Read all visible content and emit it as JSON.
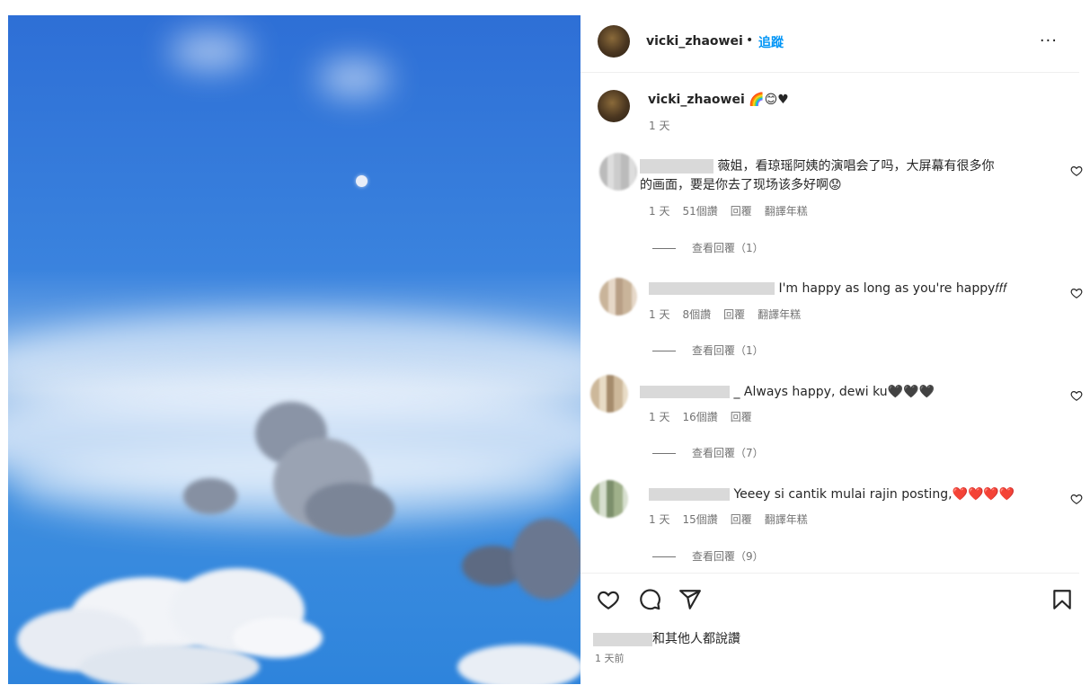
{
  "post": {
    "author": "vicki_zhaowei",
    "dot": "•",
    "follow_label": "追蹤",
    "more_label": "···",
    "caption": "🌈😊♥",
    "caption_time": "1 天"
  },
  "comments": [
    {
      "text_lines": [
        "薇姐，看琼瑶阿姨的演唱会了吗，大屏幕有很多你",
        "的画面，要是你去了现场该多好啊😟"
      ],
      "time": "1 天",
      "likes": "51個讚",
      "reply": "回覆",
      "translate": "翻譯年糕",
      "view_replies": "查看回覆（1）"
    },
    {
      "text_lines": [
        "I'm happy as long as you're happy𝑓𝑓𝑓"
      ],
      "time": "1 天",
      "likes": "8個讚",
      "reply": "回覆",
      "translate": "翻譯年糕",
      "view_replies": "查看回覆（1）"
    },
    {
      "text_lines": [
        "_ Always happy, dewi ku🖤🖤🖤"
      ],
      "time": "1 天",
      "likes": "16個讚",
      "reply": "回覆",
      "translate": "",
      "view_replies": "查看回覆（7）"
    },
    {
      "text_lines": [
        "Yeeey si cantik mulai rajin posting,❤️❤️❤️❤️"
      ],
      "time": "1 天",
      "likes": "15個讚",
      "reply": "回覆",
      "translate": "翻譯年糕",
      "view_replies": "查看回覆（9）"
    }
  ],
  "footer": {
    "likes_text": "和其他人都說讚",
    "posted_ago": "1 天前"
  },
  "icons": [
    "heart-icon",
    "comment-icon",
    "share-icon",
    "bookmark-icon",
    "more-icon"
  ]
}
